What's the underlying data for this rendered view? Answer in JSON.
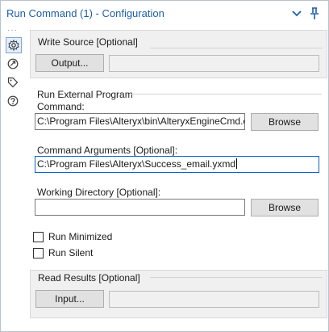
{
  "window": {
    "title": "Run Command (1) - Configuration"
  },
  "sidebar": {
    "items": [
      {
        "icon": "gear-icon"
      },
      {
        "icon": "connection-icon"
      },
      {
        "icon": "tag-icon"
      },
      {
        "icon": "help-icon"
      }
    ]
  },
  "write_source": {
    "label": "Write Source [Optional]",
    "button_label": "Output...",
    "value": ""
  },
  "run_external": {
    "label": "Run External Program",
    "command_label": "Command:",
    "command_value": "C:\\Program Files\\Alteryx\\bin\\AlteryxEngineCmd.exe",
    "command_browse": "Browse",
    "args_label": "Command Arguments [Optional]:",
    "args_value": "C:\\Program Files\\Alteryx\\Success_email.yxmd",
    "workdir_label": "Working Directory [Optional]:",
    "workdir_value": "",
    "workdir_browse": "Browse"
  },
  "options": {
    "run_minimized_label": "Run Minimized",
    "run_minimized_checked": false,
    "run_silent_label": "Run Silent",
    "run_silent_checked": false
  },
  "read_results": {
    "label": "Read Results [Optional]",
    "button_label": "Input...",
    "value": ""
  },
  "colors": {
    "title": "#1f5fa8",
    "accent": "#0a64c8"
  }
}
